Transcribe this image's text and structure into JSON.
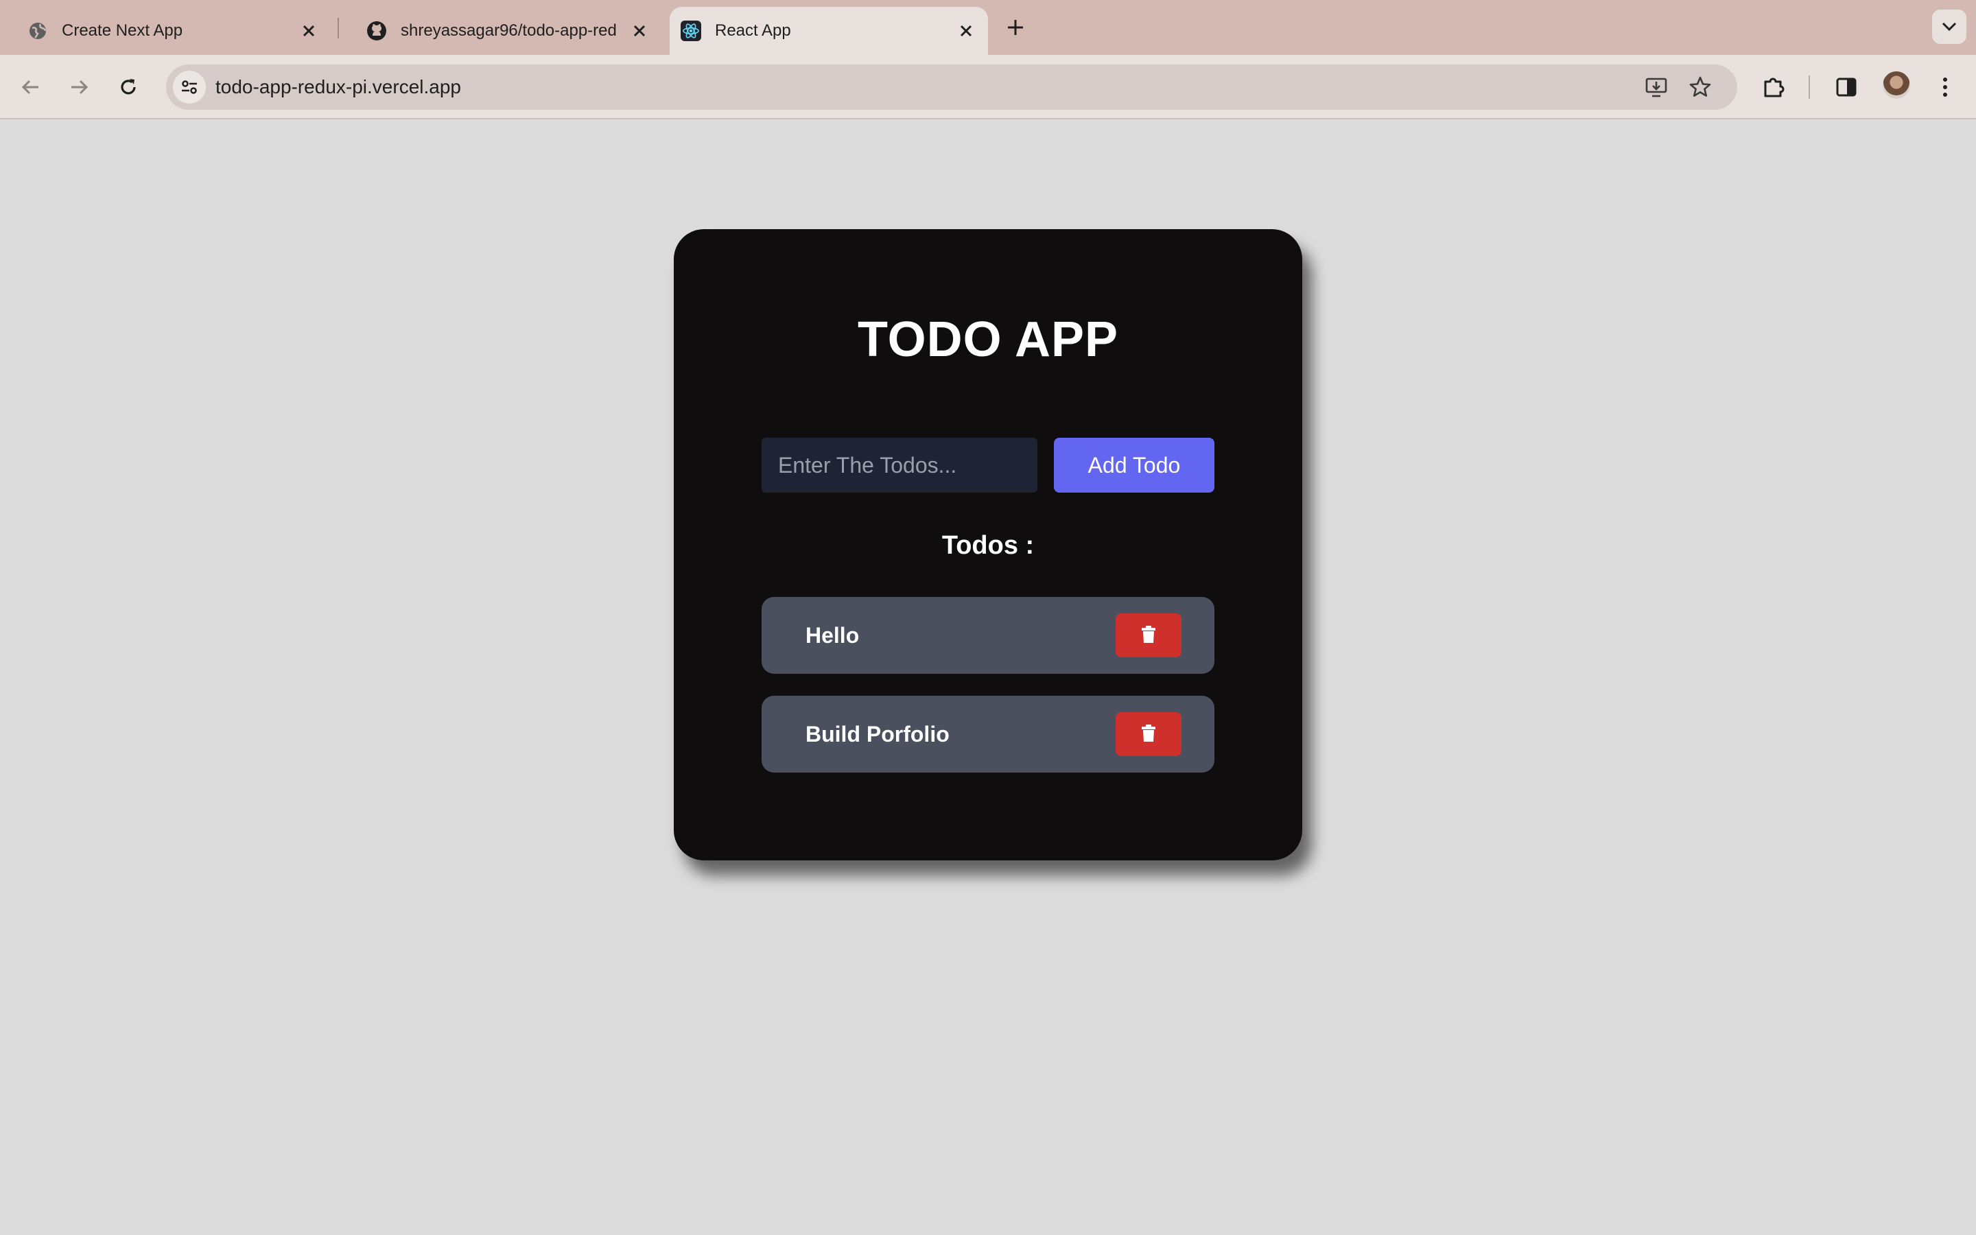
{
  "browser": {
    "tabs": [
      {
        "title": "Create Next App",
        "icon": "globe-icon",
        "active": false
      },
      {
        "title": "shreyassagar96/todo-app-red",
        "icon": "github-icon",
        "active": false
      },
      {
        "title": "React App",
        "icon": "react-icon",
        "active": true
      }
    ],
    "url": "todo-app-redux-pi.vercel.app"
  },
  "app": {
    "title": "TODO APP",
    "input": {
      "placeholder": "Enter The Todos...",
      "value": ""
    },
    "add_button_label": "Add Todo",
    "todos_heading": "Todos :",
    "todos": [
      {
        "text": "Hello"
      },
      {
        "text": "Build Porfolio"
      }
    ]
  },
  "colors": {
    "page_background": "#dcdcdc",
    "card_background": "#0f0d0d",
    "accent": "#6366f1",
    "todo_item_background": "#4b505e",
    "delete_button": "#d0302b"
  }
}
